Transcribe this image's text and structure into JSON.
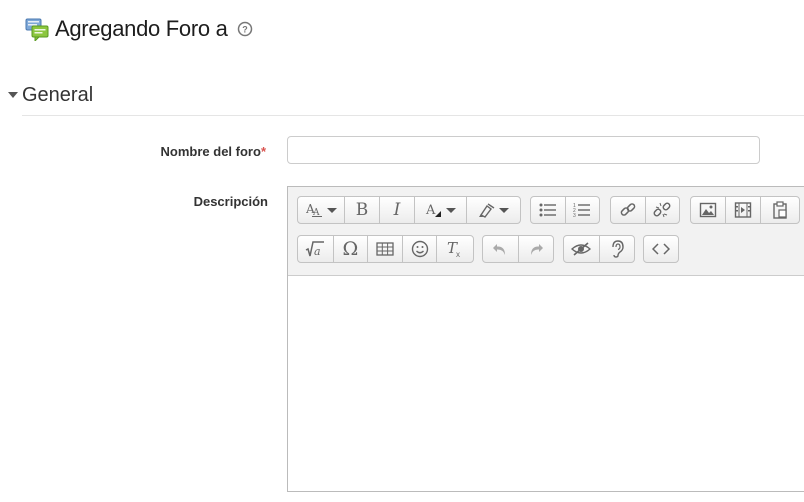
{
  "header": {
    "title": "Agregando Foro a",
    "help_icon": "question-circle-icon",
    "forum_icon": "forum-icon"
  },
  "section": {
    "title": "General"
  },
  "form": {
    "name_label": "Nombre del foro",
    "required_mark": "*",
    "name_value": "",
    "description_label": "Descripción"
  },
  "editor": {
    "toolbar_rows": [
      [
        [
          "font-size-icon",
          "bold-icon",
          "italic-icon",
          "font-color-icon",
          "highlight-icon"
        ],
        [
          "unordered-list-icon",
          "ordered-list-icon"
        ],
        [
          "link-icon",
          "unlink-icon"
        ],
        [
          "image-icon",
          "media-icon",
          "paste-icon"
        ]
      ],
      [
        [
          "equation-icon",
          "special-char-icon",
          "table-icon",
          "emoticon-icon",
          "clear-format-icon"
        ],
        [
          "undo-icon",
          "redo-icon"
        ],
        [
          "accessibility-checker-icon",
          "screenreader-helper-icon"
        ],
        [
          "html-source-icon"
        ]
      ]
    ],
    "content": ""
  },
  "colors": {
    "accent": "#f0ad4e",
    "required": "#d9534f",
    "toolbar_bg": "#f2f2f2"
  }
}
